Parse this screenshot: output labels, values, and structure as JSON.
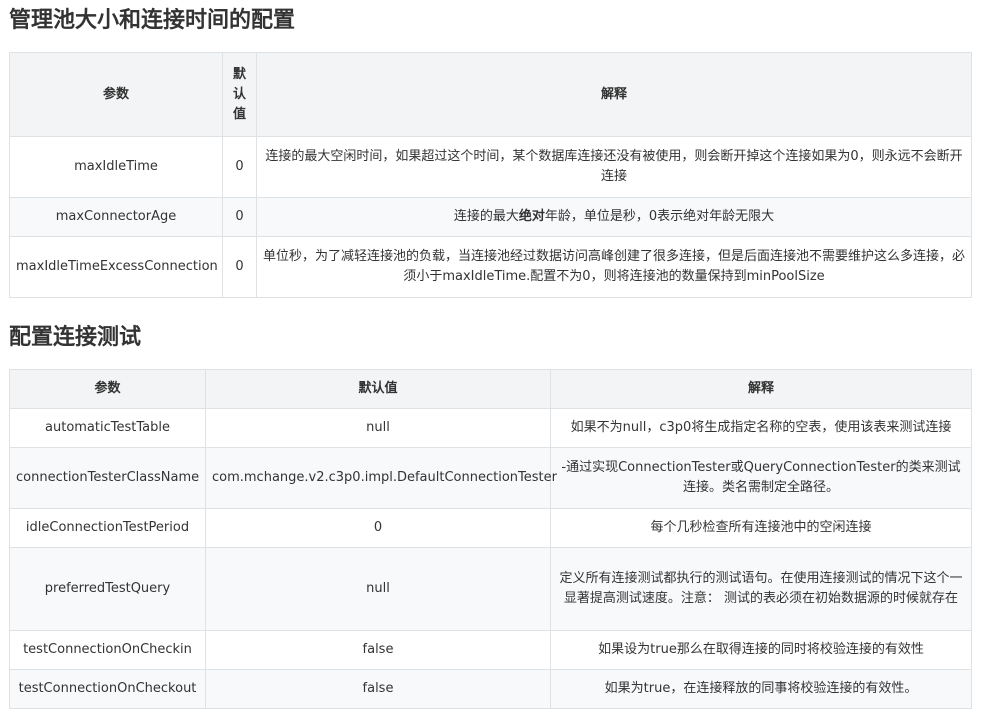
{
  "section1": {
    "title": "管理池大小和连接时间的配置",
    "headers": [
      "参数",
      "默认值",
      "解释"
    ],
    "header_default_lines": [
      "默",
      "认",
      "值"
    ],
    "rows": [
      {
        "param": "maxIdleTime",
        "default": "0",
        "desc": "连接的最大空闲时间，如果超过这个时间，某个数据库连接还没有被使用，则会断开掉这个连接如果为0，则永远不会断开连接"
      },
      {
        "param": "maxConnectorAge",
        "default": "0",
        "desc_pre": "连接的最大",
        "desc_bold": "绝对",
        "desc_post": "年龄，单位是秒，0表示绝对年龄无限大"
      },
      {
        "param": "maxIdleTimeExcessConnection",
        "default": "0",
        "desc": "单位秒，为了减轻连接池的负载，当连接池经过数据访问高峰创建了很多连接，但是后面连接池不需要维护这么多连接，必须小于maxIdleTime.配置不为0，则将连接池的数量保持到minPoolSize"
      }
    ]
  },
  "section2": {
    "title": "配置连接测试",
    "headers": [
      "参数",
      "默认值",
      "解释"
    ],
    "rows": [
      {
        "param": "automaticTestTable",
        "default": "null",
        "desc": "如果不为null，c3p0将生成指定名称的空表，使用该表来测试连接"
      },
      {
        "param": "connectionTesterClassName",
        "default": "com.mchange.v2.c3p0.impl.DefaultConnectionTester",
        "desc": "-通过实现ConnectionTester或QueryConnectionTester的类来测试连接。类名需制定全路径。"
      },
      {
        "param": "idleConnectionTestPeriod",
        "default": "0",
        "desc": "每个几秒检查所有连接池中的空闲连接"
      },
      {
        "param": "preferredTestQuery",
        "default": "null",
        "desc": "定义所有连接测试都执行的测试语句。在使用连接测试的情况下这个一显著提高测试速度。注意： 测试的表必须在初始数据源的时候就存在"
      },
      {
        "param": "testConnectionOnCheckin",
        "default": "false",
        "desc": "如果设为true那么在取得连接的同时将校验连接的有效性"
      },
      {
        "param": "testConnectionOnCheckout",
        "default": "false",
        "desc": "如果为true，在连接释放的同事将校验连接的有效性。"
      }
    ]
  }
}
